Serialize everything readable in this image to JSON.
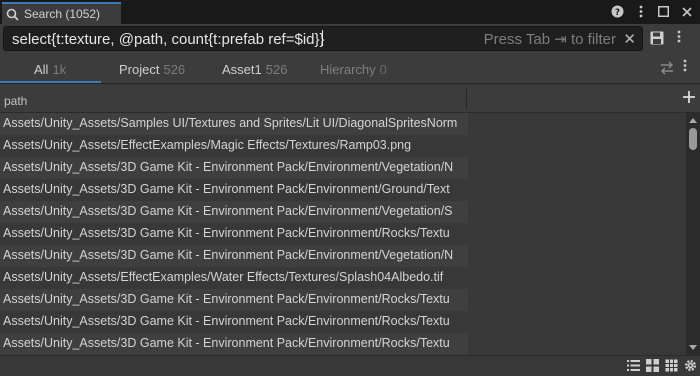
{
  "window": {
    "tab_title": "Search (1052)"
  },
  "search": {
    "query": "select{t:texture, @path, count{t:prefab ref=$id}}",
    "hint": "Press Tab ⇥ to filter"
  },
  "provider_tabs": [
    {
      "label": "All",
      "count": "1k"
    },
    {
      "label": "Project",
      "count": "526"
    },
    {
      "label": "Asset1",
      "count": "526"
    },
    {
      "label": "Hierarchy",
      "count": "0"
    }
  ],
  "table": {
    "column_header": "path",
    "rows": [
      "Assets/Unity_Assets/Samples UI/Textures and Sprites/Lit UI/DiagonalSpritesNorm",
      "Assets/Unity_Assets/EffectExamples/Magic Effects/Textures/Ramp03.png",
      "Assets/Unity_Assets/3D Game Kit - Environment Pack/Environment/Vegetation/N",
      "Assets/Unity_Assets/3D Game Kit - Environment Pack/Environment/Ground/Text",
      "Assets/Unity_Assets/3D Game Kit - Environment Pack/Environment/Vegetation/S",
      "Assets/Unity_Assets/3D Game Kit - Environment Pack/Environment/Rocks/Textu",
      "Assets/Unity_Assets/3D Game Kit - Environment Pack/Environment/Vegetation/N",
      "Assets/Unity_Assets/EffectExamples/Water Effects/Textures/Splash04Albedo.tif",
      "Assets/Unity_Assets/3D Game Kit - Environment Pack/Environment/Rocks/Textu",
      "Assets/Unity_Assets/3D Game Kit - Environment Pack/Environment/Rocks/Textu",
      "Assets/Unity_Assets/3D Game Kit - Environment Pack/Environment/Rocks/Textu"
    ]
  },
  "colors": {
    "accent": "#3a79bb",
    "background": "#383838",
    "row_alt": "#3f3f3f"
  }
}
